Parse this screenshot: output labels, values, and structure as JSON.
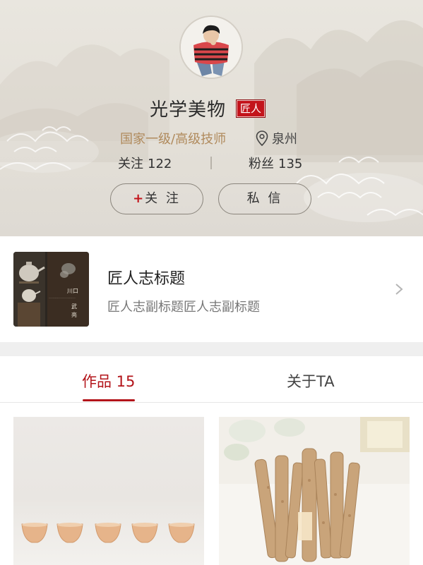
{
  "profile": {
    "name": "光学美物",
    "badge": "匠人",
    "level": "国家一级/高级技师",
    "location": "泉州",
    "following_label": "关注",
    "following_count": "122",
    "fans_label": "粉丝",
    "fans_count": "135",
    "follow_plus": "+",
    "follow_button": "关 注",
    "message_button": "私 信"
  },
  "journal": {
    "title": "匠人志标题",
    "subtitle": "匠人志副标题匠人志副标题"
  },
  "tabs": [
    {
      "label": "作品 15",
      "active": true
    },
    {
      "label": "关于TA",
      "active": false
    }
  ],
  "theme": {
    "accent": "#b3141a",
    "badge_bg": "#c3141b",
    "level_color": "#b08a5c"
  },
  "icons": {
    "location": "location-pin-icon",
    "chevron": "chevron-right-icon"
  }
}
